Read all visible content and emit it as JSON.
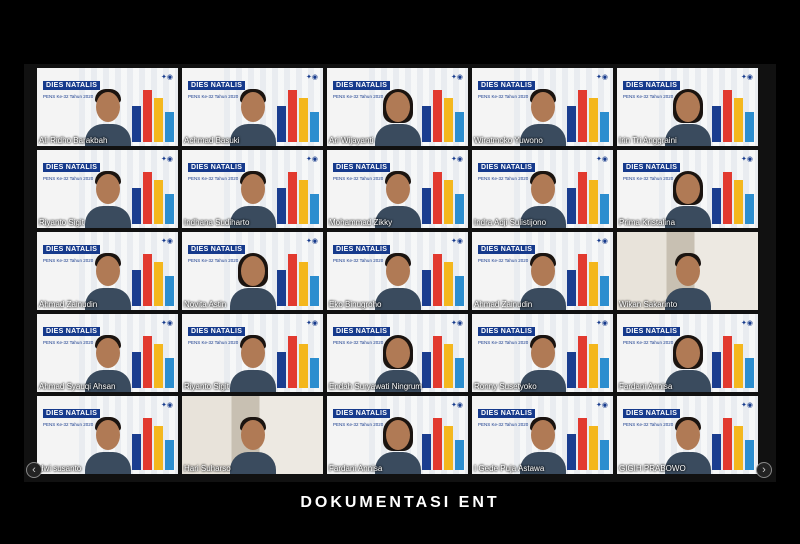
{
  "meeting": {
    "banner_title": "DIES NATALIS",
    "banner_subtitle": "PENS Ke-32 Tahun 2020",
    "participants": [
      {
        "name": "Ali Ridho Barakbah",
        "hijab": false
      },
      {
        "name": "Achmad Basuki",
        "hijab": false
      },
      {
        "name": "Ari Wijayanti",
        "hijab": true
      },
      {
        "name": "Wiratmoko Yuwono",
        "hijab": false
      },
      {
        "name": "Irin Tri Anggraini",
        "hijab": true
      },
      {
        "name": "Riyanto Sigit",
        "hijab": false
      },
      {
        "name": "Indhana Sudiharto",
        "hijab": false
      },
      {
        "name": "Mohammad Zikky",
        "hijab": false
      },
      {
        "name": "Indra Adji Sulistijono",
        "hijab": false
      },
      {
        "name": "Prima Kristalina",
        "hijab": true
      },
      {
        "name": "Ahmad Zainudin",
        "hijab": false
      },
      {
        "name": "Novita Astin",
        "hijab": true
      },
      {
        "name": "Eko Binugroho",
        "hijab": false
      },
      {
        "name": "Ahmad Zainudin",
        "hijab": false
      },
      {
        "name": "Wikan Sakarinto",
        "hijab": false,
        "room": true
      },
      {
        "name": "Ahmad Syauqi Ahsan",
        "hijab": false
      },
      {
        "name": "Riyanto Sigit",
        "hijab": false
      },
      {
        "name": "Endah Suryawati Ningrum",
        "hijab": true
      },
      {
        "name": "Ronny Susetyoko",
        "hijab": false
      },
      {
        "name": "Fardani Annisa",
        "hijab": true
      },
      {
        "name": "dwi susanto",
        "hijab": false
      },
      {
        "name": "Hari Suharso",
        "hijab": false,
        "room": true
      },
      {
        "name": "Fardani Annisa",
        "hijab": true
      },
      {
        "name": "I Gede Puja Astawa",
        "hijab": false
      },
      {
        "name": "GIGIH PRABOWO",
        "hijab": false
      }
    ]
  },
  "nav": {
    "prev_icon": "‹",
    "next_icon": "›"
  },
  "caption": "DOKUMENTASI ENT",
  "colors": {
    "banner_blue": "#163a8c",
    "bar_red": "#e23a2f",
    "bar_yellow": "#f4b71d"
  }
}
